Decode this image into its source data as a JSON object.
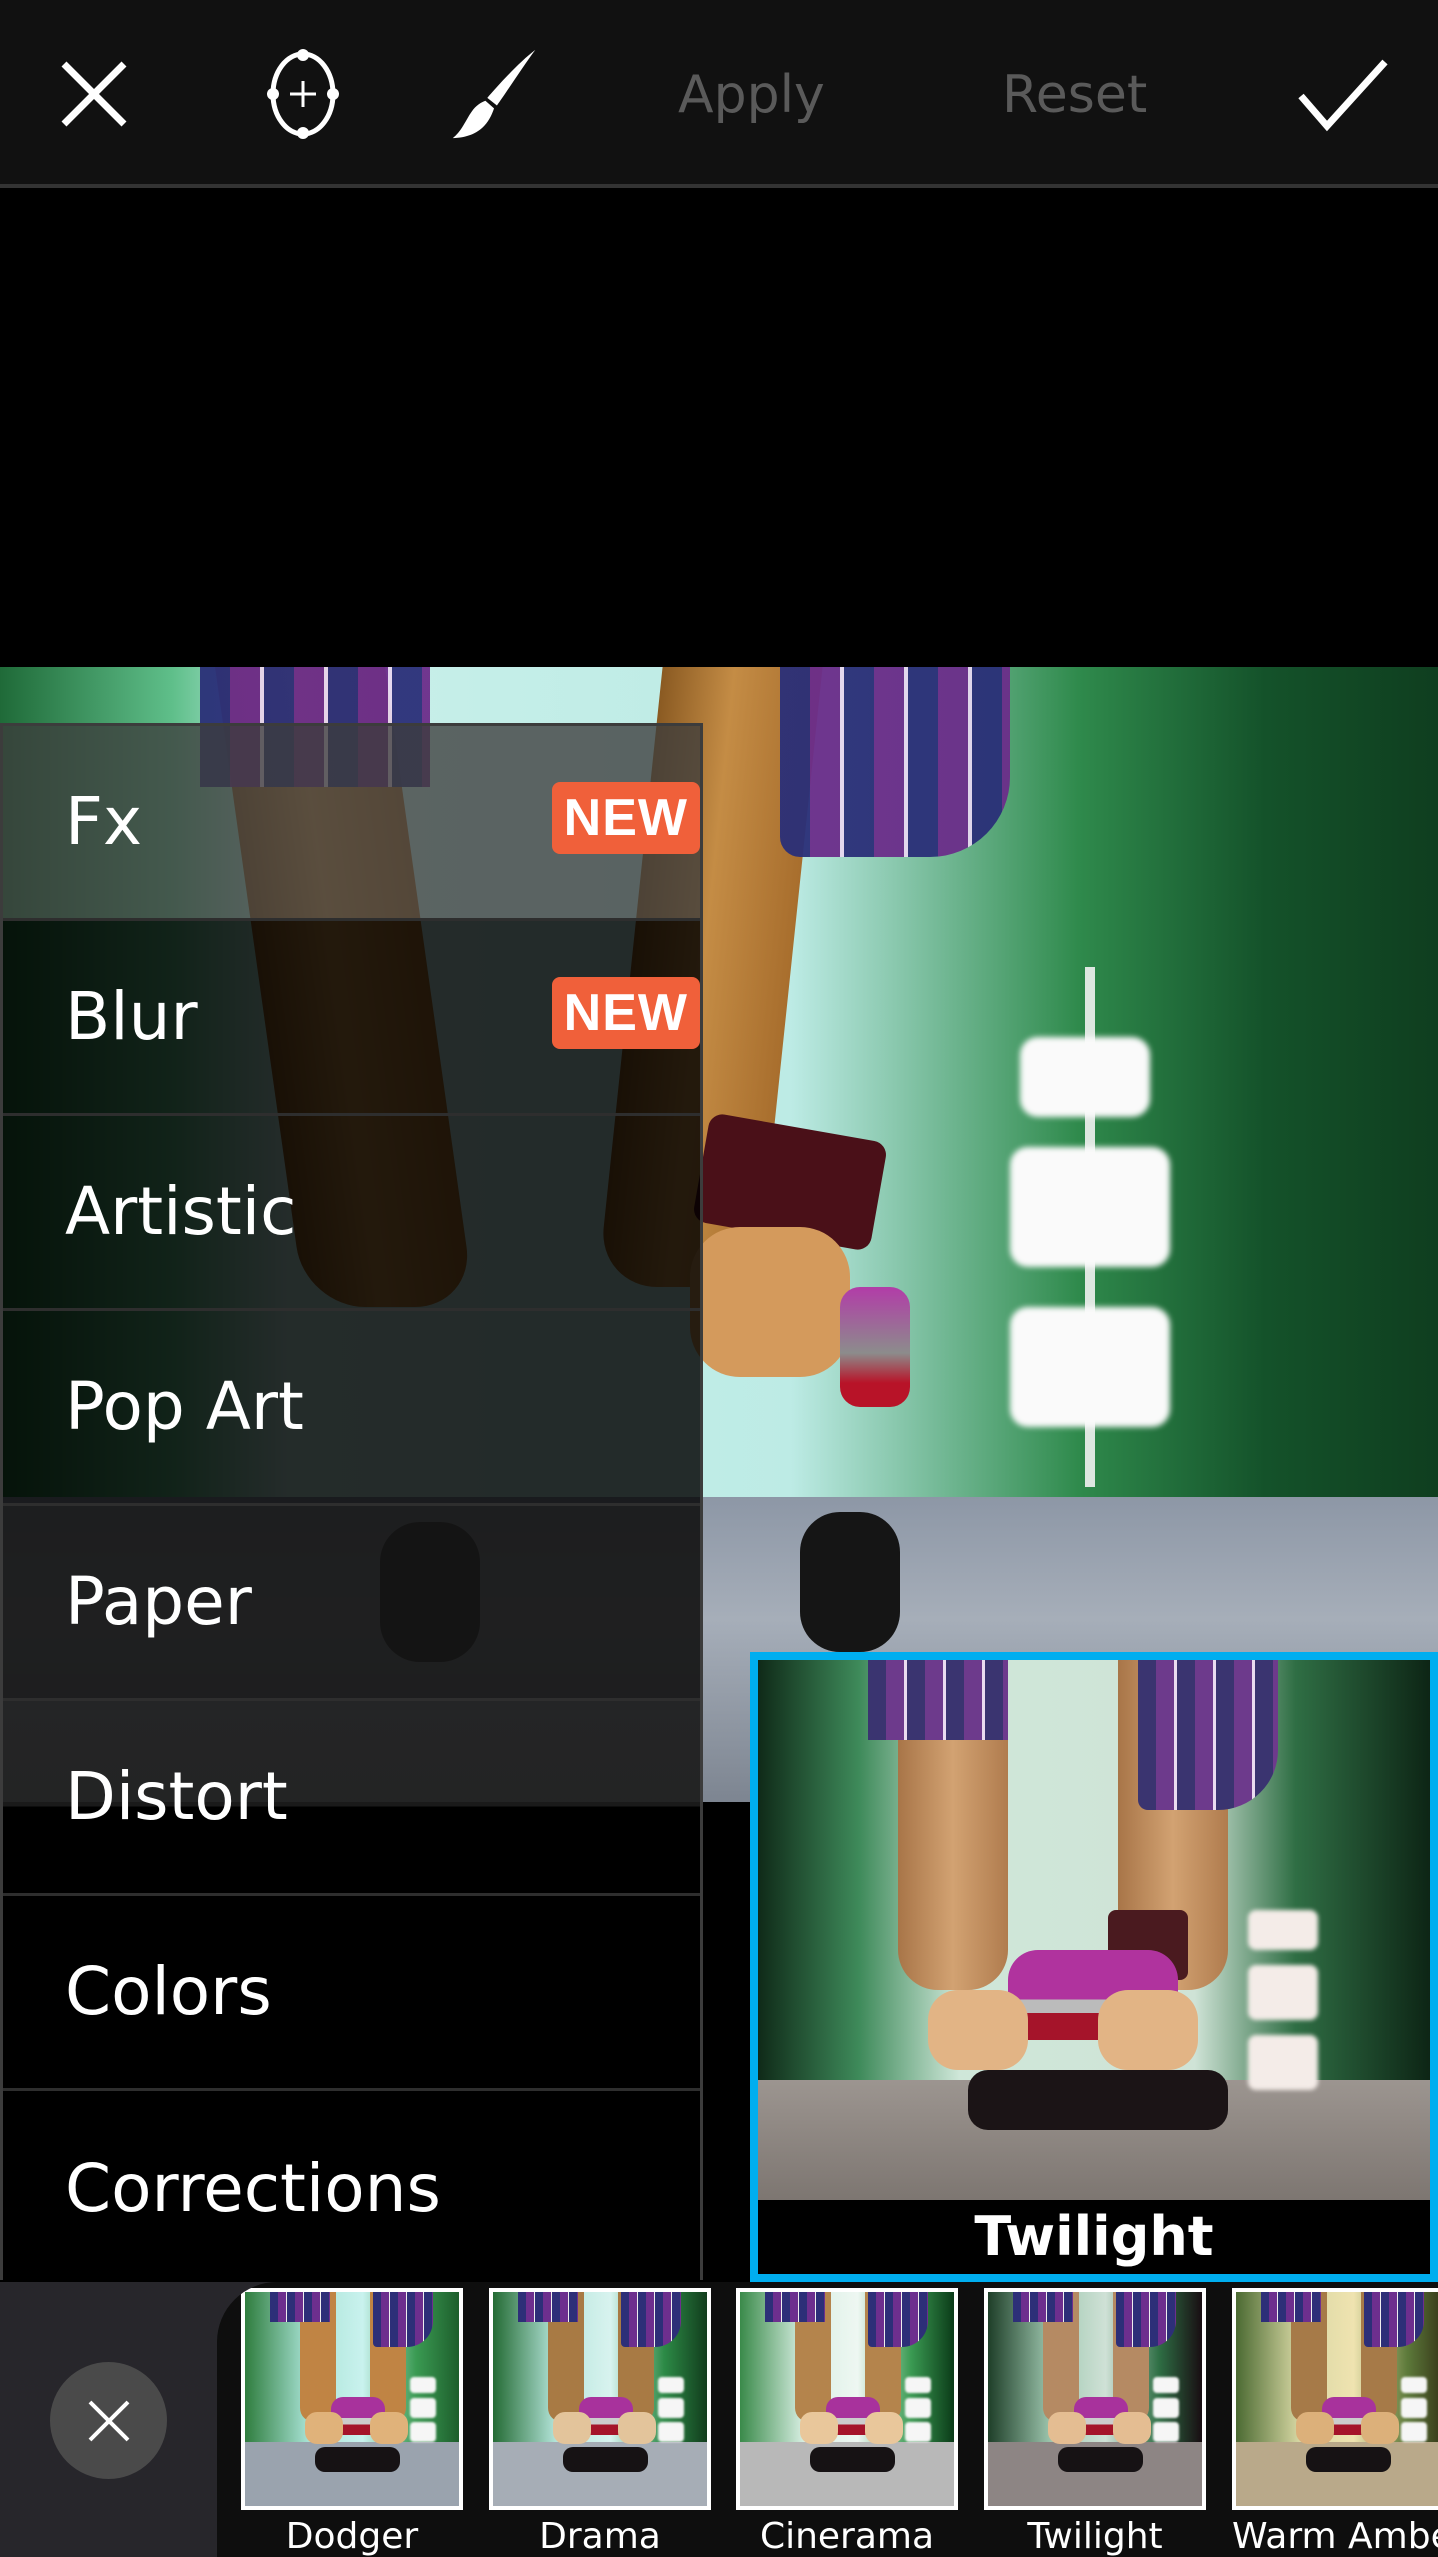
{
  "toolbar": {
    "close_icon": "close-icon",
    "selection_icon": "ellipse-selection-icon",
    "brush_icon": "brush-icon",
    "apply_label": "Apply",
    "reset_label": "Reset",
    "confirm_icon": "checkmark-icon",
    "disabled_text_color": "#5a5a5a"
  },
  "effect_categories": {
    "items": [
      {
        "label": "Fx",
        "badge": "NEW"
      },
      {
        "label": "Blur",
        "badge": "NEW"
      },
      {
        "label": "Artistic"
      },
      {
        "label": "Pop Art"
      },
      {
        "label": "Paper"
      },
      {
        "label": "Distort"
      },
      {
        "label": "Colors"
      },
      {
        "label": "Corrections"
      }
    ],
    "badge_color": "#f0603a"
  },
  "preview": {
    "label": "Twilight",
    "border_color": "#00aeef"
  },
  "filter_strip": {
    "cancel_icon": "close-icon",
    "thumbnails": [
      {
        "label": "Dodger"
      },
      {
        "label": "Drama"
      },
      {
        "label": "Cinerama"
      },
      {
        "label": "Twilight"
      },
      {
        "label": "Warm Amber"
      }
    ]
  }
}
